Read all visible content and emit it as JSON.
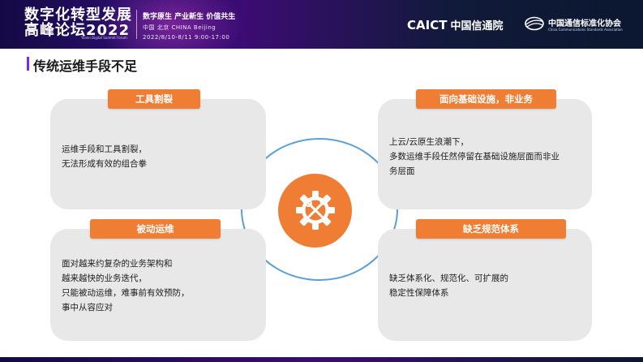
{
  "header": {
    "forum_title_line1": "数字化转型发展",
    "forum_title_line2": "高峰论坛2022",
    "forum_subtitle": "Yunlei Digital Summit Forum",
    "slogan": "数字原生 产业新生 价值共生",
    "location": "中国 北京  CHINA  Beijing",
    "datetime": "2022/8/10-8/11    9:00-17:00",
    "caict_en": "CAICT",
    "caict_cn": "中国信通院",
    "ccsa_name": "中国通信标准化协会",
    "ccsa_en": "China Communications Standards Association"
  },
  "page": {
    "title": "传统运维手段不足"
  },
  "cards": {
    "top_left": {
      "label": "工具割裂",
      "lines": [
        "运维手段和工具割裂，",
        "无法形成有效的组合拳"
      ]
    },
    "bottom_left": {
      "label": "被动运维",
      "lines": [
        "面对越来约复杂的业务架构和",
        "越来越快的业务迭代，",
        "只能被动运维，难事前有效预防，",
        "事中从容应对"
      ]
    },
    "top_right": {
      "label": "面向基础设施，非业务",
      "lines": [
        "上云/云原生浪潮下，",
        "多数运维手段任然停留在基础设施层面而非业",
        "务层面"
      ]
    },
    "bottom_right": {
      "label": "缺乏规范体系",
      "lines": [
        "缺乏体系化、规范化、可扩展的",
        "稳定性保障体系"
      ]
    }
  },
  "icons": {
    "center": "gear-tools-icon",
    "logo": "ccsa-globe-icon"
  },
  "colors": {
    "accent_orange": "#ef7d33",
    "ring_blue": "#5b9fd6",
    "title_accent": "#7b2bd9",
    "card_bg": "#e8e8e8"
  }
}
